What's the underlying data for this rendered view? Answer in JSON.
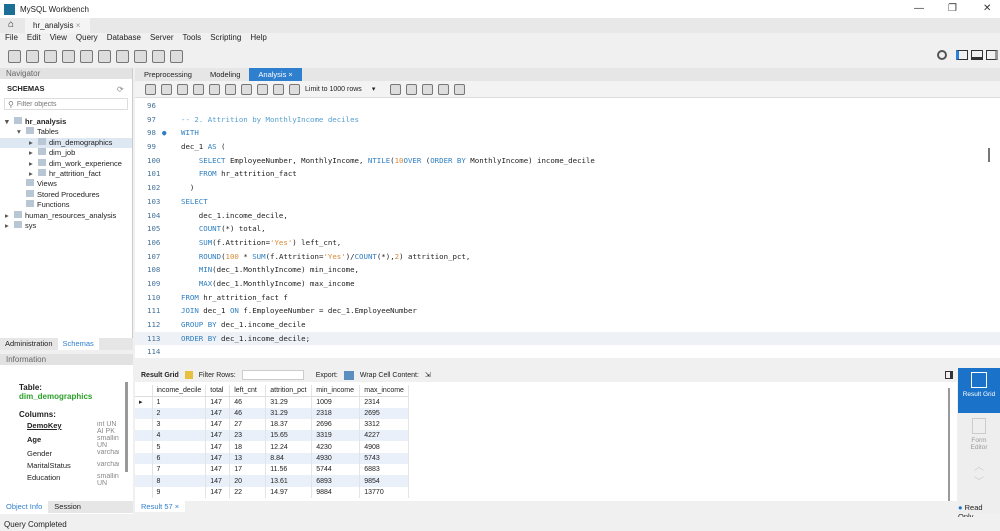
{
  "window": {
    "title": "MySQL Workbench",
    "min": "—",
    "max": "❐",
    "close": "✕"
  },
  "doc_tab": {
    "label": "hr_analysis",
    "close": "×"
  },
  "menu": [
    "File",
    "Edit",
    "View",
    "Query",
    "Database",
    "Server",
    "Tools",
    "Scripting",
    "Help"
  ],
  "navigator": {
    "header": "Navigator",
    "schemas_label": "SCHEMAS",
    "filter_placeholder": "Filter objects",
    "tree": [
      {
        "label": "hr_analysis",
        "level": 0,
        "bold": true,
        "arrow": "▾"
      },
      {
        "label": "Tables",
        "level": 1,
        "arrow": "▾"
      },
      {
        "label": "dim_demographics",
        "level": 2,
        "arrow": "▸",
        "selected": true
      },
      {
        "label": "dim_job",
        "level": 2,
        "arrow": "▸"
      },
      {
        "label": "dim_work_experience",
        "level": 2,
        "arrow": "▸"
      },
      {
        "label": "hr_attrition_fact",
        "level": 2,
        "arrow": "▸"
      },
      {
        "label": "Views",
        "level": 1,
        "arrow": ""
      },
      {
        "label": "Stored Procedures",
        "level": 1,
        "arrow": ""
      },
      {
        "label": "Functions",
        "level": 1,
        "arrow": ""
      },
      {
        "label": "human_resources_analysis",
        "level": 0,
        "arrow": "▸"
      },
      {
        "label": "sys",
        "level": 0,
        "arrow": "▸"
      }
    ],
    "bottom_tabs": [
      "Administration",
      "Schemas"
    ]
  },
  "information": {
    "header": "Information",
    "table_label": "Table:",
    "table_name": "dim_demographics",
    "columns_label": "Columns:",
    "columns": [
      {
        "name": "DemoKey",
        "type": "int UN AI PK"
      },
      {
        "name": "Age",
        "type": "smallint UN"
      },
      {
        "name": "Gender",
        "type": "varchar"
      },
      {
        "name": "MaritalStatus",
        "type": "varchar"
      },
      {
        "name": "Education",
        "type": "smallint UN"
      }
    ],
    "tabs": [
      "Object Info",
      "Session"
    ]
  },
  "editor": {
    "tabs": [
      "Preprocessing",
      "Modeling",
      "Analysis"
    ],
    "active_tab_close": "×",
    "limit": "Limit to 1000 rows",
    "lines": [
      {
        "n": "96",
        "t": []
      },
      {
        "n": "97",
        "t": [
          [
            "cm",
            "-- 2. Attrition by MonthlyIncome deciles"
          ]
        ]
      },
      {
        "n": "98",
        "t": [
          [
            "kw",
            "WITH"
          ]
        ]
      },
      {
        "n": "99",
        "t": [
          [
            "",
            "dec_1 "
          ],
          [
            "kw",
            "AS"
          ],
          [
            "",
            " ("
          ]
        ]
      },
      {
        "n": "100",
        "t": [
          [
            "",
            "    "
          ],
          [
            "kw",
            "SELECT"
          ],
          [
            "",
            " EmployeeNumber, MonthlyIncome, "
          ],
          [
            "kw",
            "NTILE"
          ],
          [
            "",
            "("
          ],
          [
            "nm",
            "10"
          ],
          [
            ") "
          ],
          [
            "kw",
            "OVER"
          ],
          [
            "",
            " ("
          ],
          [
            "kw",
            "ORDER BY"
          ],
          [
            "",
            " MonthlyIncome) income_decile"
          ]
        ]
      },
      {
        "n": "101",
        "t": [
          [
            "",
            "    "
          ],
          [
            "kw",
            "FROM"
          ],
          [
            "",
            " hr_attrition_fact"
          ]
        ]
      },
      {
        "n": "102",
        "t": [
          [
            "",
            "  )"
          ]
        ]
      },
      {
        "n": "103",
        "t": [
          [
            "kw",
            "SELECT"
          ]
        ]
      },
      {
        "n": "104",
        "t": [
          [
            "",
            "    dec_1.income_decile,"
          ]
        ]
      },
      {
        "n": "105",
        "t": [
          [
            "",
            "    "
          ],
          [
            "kw",
            "COUNT"
          ],
          [
            "",
            "(*) total,"
          ]
        ]
      },
      {
        "n": "106",
        "t": [
          [
            "",
            "    "
          ],
          [
            "kw",
            "SUM"
          ],
          [
            "",
            "(f.Attrition="
          ],
          [
            "st",
            "'Yes'"
          ],
          [
            "",
            ") left_cnt,"
          ]
        ]
      },
      {
        "n": "107",
        "t": [
          [
            "",
            "    "
          ],
          [
            "kw",
            "ROUND"
          ],
          [
            "",
            "("
          ],
          [
            "nm",
            "100"
          ],
          [
            "",
            " * "
          ],
          [
            "kw",
            "SUM"
          ],
          [
            "",
            "(f.Attrition="
          ],
          [
            "st",
            "'Yes'"
          ],
          [
            "",
            ")/"
          ],
          [
            "kw",
            "COUNT"
          ],
          [
            "",
            "(*),"
          ],
          [
            "nm",
            "2"
          ],
          [
            "",
            ") attrition_pct,"
          ]
        ]
      },
      {
        "n": "108",
        "t": [
          [
            "",
            "    "
          ],
          [
            "kw",
            "MIN"
          ],
          [
            "",
            "(dec_1.MonthlyIncome) min_income,"
          ]
        ]
      },
      {
        "n": "109",
        "t": [
          [
            "",
            "    "
          ],
          [
            "kw",
            "MAX"
          ],
          [
            "",
            "(dec_1.MonthlyIncome) max_income"
          ]
        ]
      },
      {
        "n": "110",
        "t": [
          [
            "kw",
            "FROM"
          ],
          [
            "",
            " hr_attrition_fact f"
          ]
        ]
      },
      {
        "n": "111",
        "t": [
          [
            "kw",
            "JOIN"
          ],
          [
            "",
            " dec_1 "
          ],
          [
            "kw",
            "ON"
          ],
          [
            "",
            " f.EmployeeNumber = dec_1.EmployeeNumber"
          ]
        ]
      },
      {
        "n": "112",
        "t": [
          [
            "kw",
            "GROUP BY"
          ],
          [
            "",
            " dec_1.income_decile"
          ]
        ]
      },
      {
        "n": "113",
        "t": [
          [
            "kw",
            "ORDER BY"
          ],
          [
            "",
            " dec_1.income_decile;"
          ]
        ]
      },
      {
        "n": "114",
        "t": []
      }
    ]
  },
  "result": {
    "grid_label": "Result Grid",
    "filter_label": "Filter Rows:",
    "export_label": "Export:",
    "wrap_label": "Wrap Cell Content:",
    "columns": [
      "income_decile",
      "total",
      "left_cnt",
      "attrition_pct",
      "min_income",
      "max_income"
    ],
    "rows": [
      [
        "1",
        "147",
        "46",
        "31.29",
        "1009",
        "2314"
      ],
      [
        "2",
        "147",
        "46",
        "31.29",
        "2318",
        "2695"
      ],
      [
        "3",
        "147",
        "27",
        "18.37",
        "2696",
        "3312"
      ],
      [
        "4",
        "147",
        "23",
        "15.65",
        "3319",
        "4227"
      ],
      [
        "5",
        "147",
        "18",
        "12.24",
        "4230",
        "4908"
      ],
      [
        "6",
        "147",
        "13",
        "8.84",
        "4930",
        "5743"
      ],
      [
        "7",
        "147",
        "17",
        "11.56",
        "5744",
        "6883"
      ],
      [
        "8",
        "147",
        "20",
        "13.61",
        "6893",
        "9854"
      ],
      [
        "9",
        "147",
        "22",
        "14.97",
        "9884",
        "13770"
      ]
    ],
    "tab": "Result 57",
    "side_result_grid": "Result Grid",
    "side_form_editor": "Form Editor",
    "read_only": "Read Only"
  },
  "status": "Query Completed"
}
